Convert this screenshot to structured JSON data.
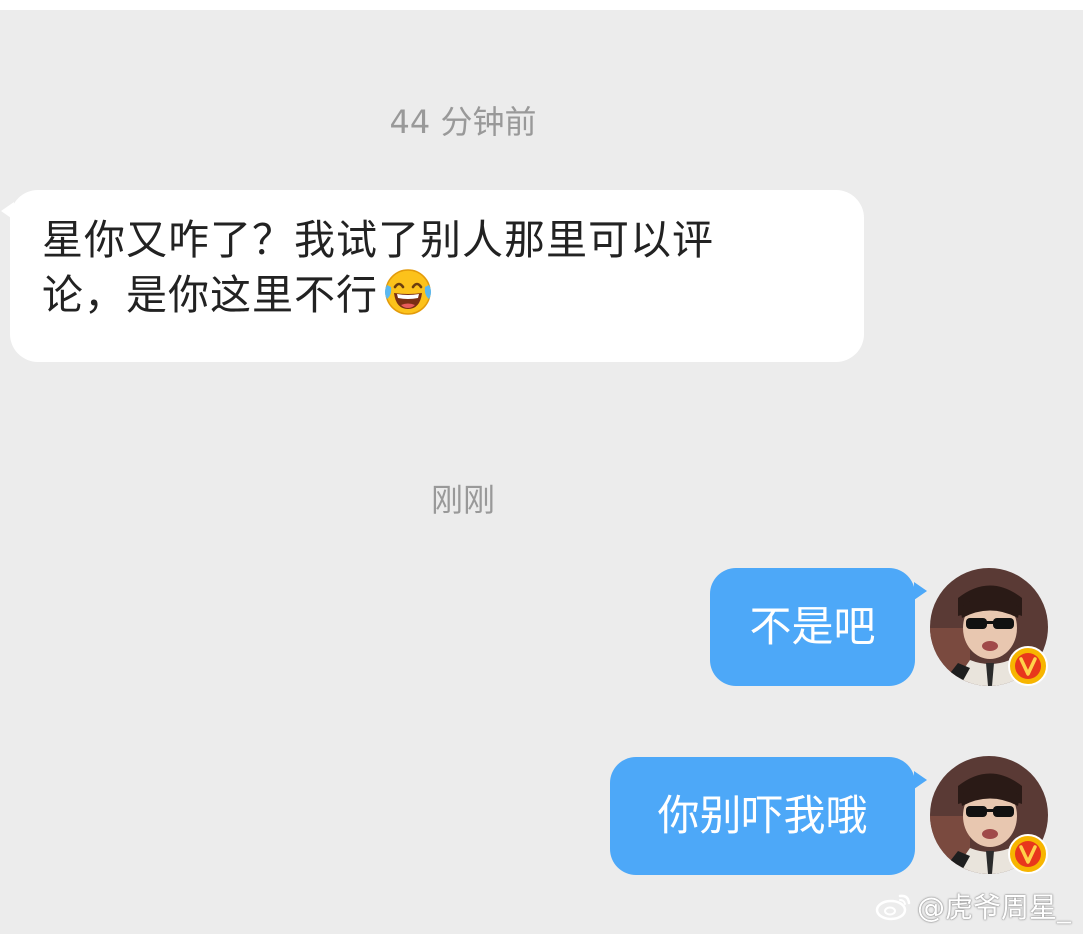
{
  "conversation": {
    "timestamp_1": "44 分钟前",
    "incoming_message": {
      "line_1": "星你又咋了？我试了别人那里可以评",
      "line_2": "论，是你这里不行",
      "emoji": "laughing-tears-emoji"
    },
    "timestamp_2": "刚刚",
    "outgoing_messages": [
      {
        "text": "不是吧"
      },
      {
        "text": "你别吓我哦"
      }
    ]
  },
  "avatar": {
    "badge": "V",
    "badge_color": "#f5a623",
    "badge_inner_color": "#e8371c"
  },
  "watermark": {
    "text": "@虎爷周星_",
    "icon": "weibo-logo-icon"
  },
  "colors": {
    "background": "#ececec",
    "incoming_bubble": "#ffffff",
    "outgoing_bubble": "#4da8f8",
    "timestamp_text": "#999999"
  }
}
